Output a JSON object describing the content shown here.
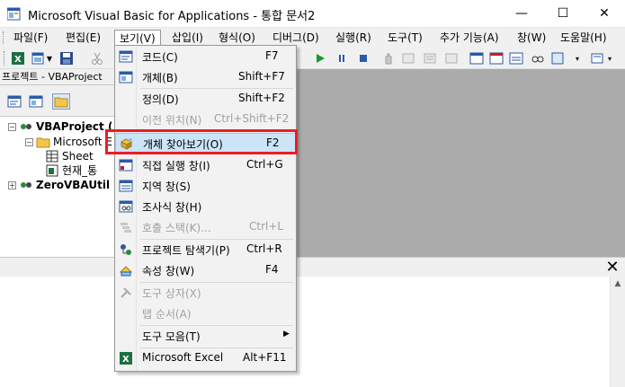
{
  "window": {
    "title": "Microsoft Visual Basic for Applications - 통합 문서2",
    "minimize_glyph": "—",
    "maximize_glyph": "☐",
    "close_glyph": "✕"
  },
  "menubar": {
    "items": [
      {
        "label": "파일(F)"
      },
      {
        "label": "편집(E)"
      },
      {
        "label": "보기(V)"
      },
      {
        "label": "삽입(I)"
      },
      {
        "label": "형식(O)"
      },
      {
        "label": "디버그(D)"
      },
      {
        "label": "실행(R)"
      },
      {
        "label": "도구(T)"
      },
      {
        "label": "추가 기능(A)"
      },
      {
        "label": "창(W)"
      },
      {
        "label": "도움말(H)"
      }
    ]
  },
  "project": {
    "title": "프로젝트 - VBAProject",
    "tree": [
      {
        "label": "VBAProject ("
      },
      {
        "label": "Microsoft E"
      },
      {
        "label": "Sheet"
      },
      {
        "label": "현재_통"
      },
      {
        "label": "ZeroVBAUtil"
      }
    ]
  },
  "view_menu": {
    "items": [
      {
        "label": "코드(C)",
        "shortcut": "F7"
      },
      {
        "label": "개체(B)",
        "shortcut": "Shift+F7"
      },
      {
        "label": "정의(D)",
        "shortcut": "Shift+F2"
      },
      {
        "label": "이전 위치(N)",
        "shortcut": "Ctrl+Shift+F2"
      },
      {
        "label": "개체 찾아보기(O)",
        "shortcut": "F2"
      },
      {
        "label": "직접 실행 창(I)",
        "shortcut": "Ctrl+G"
      },
      {
        "label": "지역 창(S)",
        "shortcut": ""
      },
      {
        "label": "조사식 창(H)",
        "shortcut": ""
      },
      {
        "label": "호출 스택(K)...",
        "shortcut": "Ctrl+L"
      },
      {
        "label": "프로젝트 탐색기(P)",
        "shortcut": "Ctrl+R"
      },
      {
        "label": "속성 창(W)",
        "shortcut": "F4"
      },
      {
        "label": "도구 상자(X)",
        "shortcut": ""
      },
      {
        "label": "탭 순서(A)",
        "shortcut": ""
      },
      {
        "label": "도구 모음(T)",
        "shortcut": ""
      },
      {
        "label": "Microsoft Excel",
        "shortcut": "Alt+F11"
      }
    ]
  },
  "bottom_panel": {
    "close_glyph": "✕"
  },
  "colors": {
    "highlight_box": "#ee1c24",
    "menu_hover": "#cce4f7",
    "workspace": "#ababab"
  }
}
